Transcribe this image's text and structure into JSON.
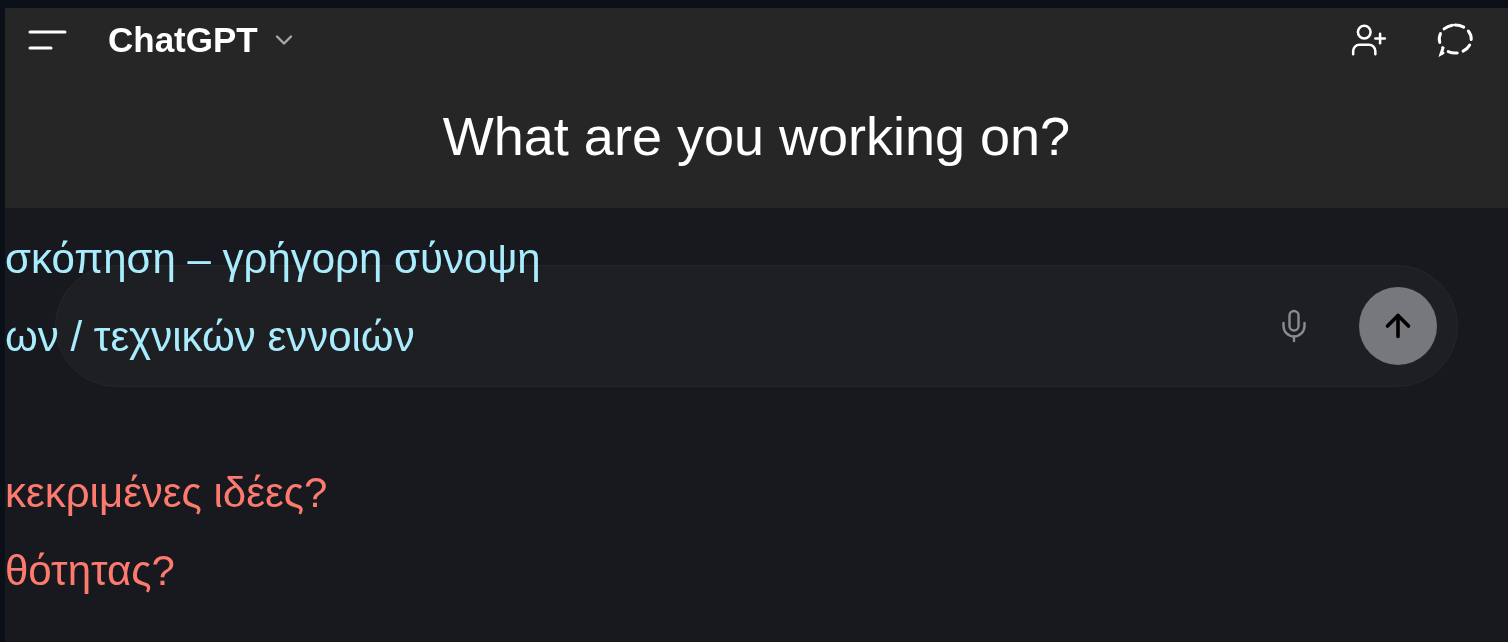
{
  "header": {
    "model_name": "ChatGPT"
  },
  "heading": "What are you working on?",
  "overlay_groups": [
    [
      {
        "text": "σκόπηση – γρήγορη σύνοψη",
        "color": "#a8ecfd"
      },
      {
        "text": "ων / τεχνικών εννοιών",
        "color": "#a8ecfd"
      }
    ],
    [
      {
        "text": "κεκριμένες ιδέες?",
        "color": "#ff7a6e"
      },
      {
        "text": "θότητας?",
        "color": "#ff7a6e"
      }
    ]
  ]
}
